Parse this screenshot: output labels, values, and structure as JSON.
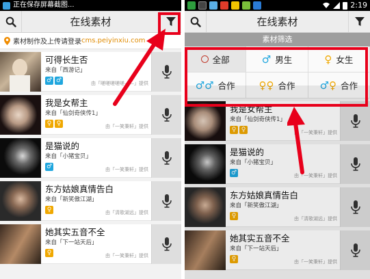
{
  "left": {
    "status_text": "正在保存屏幕截图...",
    "title": "在线素材",
    "banner_text": "素材制作及上传请登录",
    "banner_link": "cms.peiyinxiu.com",
    "items": [
      {
        "title": "可得长生否",
        "source": "来自「西游记」",
        "provider": "由「嗟嗟嗟嗟嗟——」提供",
        "badges": [
          "male",
          "male2"
        ]
      },
      {
        "title": "我是女帮主",
        "source": "来自「仙剑奇侠传1」",
        "provider": "由「一笑秉轩」提供",
        "badges": [
          "female",
          "female"
        ]
      },
      {
        "title": "是猫说的",
        "source": "来自「小猪宝贝」",
        "provider": "由「一笑秉轩」提供",
        "badges": [
          "male"
        ]
      },
      {
        "title": "东方姑娘真情告白",
        "source": "来自「新笑傲江湖」",
        "provider": "由「清歌湖远」提供",
        "badges": [
          "female"
        ]
      },
      {
        "title": "她其实五音不全",
        "source": "来自「下一站天后」",
        "provider": "由「一笑秉轩」提供",
        "badges": [
          "female"
        ]
      }
    ]
  },
  "right": {
    "time": "2:19",
    "title": "在线素材",
    "filter_header": "素材筛选",
    "filter_options": [
      {
        "label": "全部",
        "icon": "all-ring-icon"
      },
      {
        "label": "男生",
        "icon": "male-icon"
      },
      {
        "label": "女生",
        "icon": "female-icon"
      },
      {
        "label": "合作",
        "icon": "male-male-icon"
      },
      {
        "label": "合作",
        "icon": "female-female-icon"
      },
      {
        "label": "合作",
        "icon": "male-female-icon"
      }
    ],
    "items": [
      {
        "title": "我是女帮主",
        "source": "来自「仙剑奇侠传1」",
        "provider": "由「一笑秉轩」提供",
        "badges": [
          "female",
          "female"
        ]
      },
      {
        "title": "是猫说的",
        "source": "来自「小猪宝贝」",
        "provider": "由「一笑秉轩」提供",
        "badges": [
          "male"
        ]
      },
      {
        "title": "东方姑娘真情告白",
        "source": "来自「新笑傲江湖」",
        "provider": "由「清歌湖远」提供",
        "badges": [
          "female"
        ]
      },
      {
        "title": "她其实五音不全",
        "source": "来自「下一站天后」",
        "provider": "由「一笑秉轩」提供",
        "badges": [
          "female"
        ]
      }
    ]
  },
  "colors": {
    "highlight": "#e8001b",
    "male": "#1fa6de",
    "female": "#f0a800"
  }
}
